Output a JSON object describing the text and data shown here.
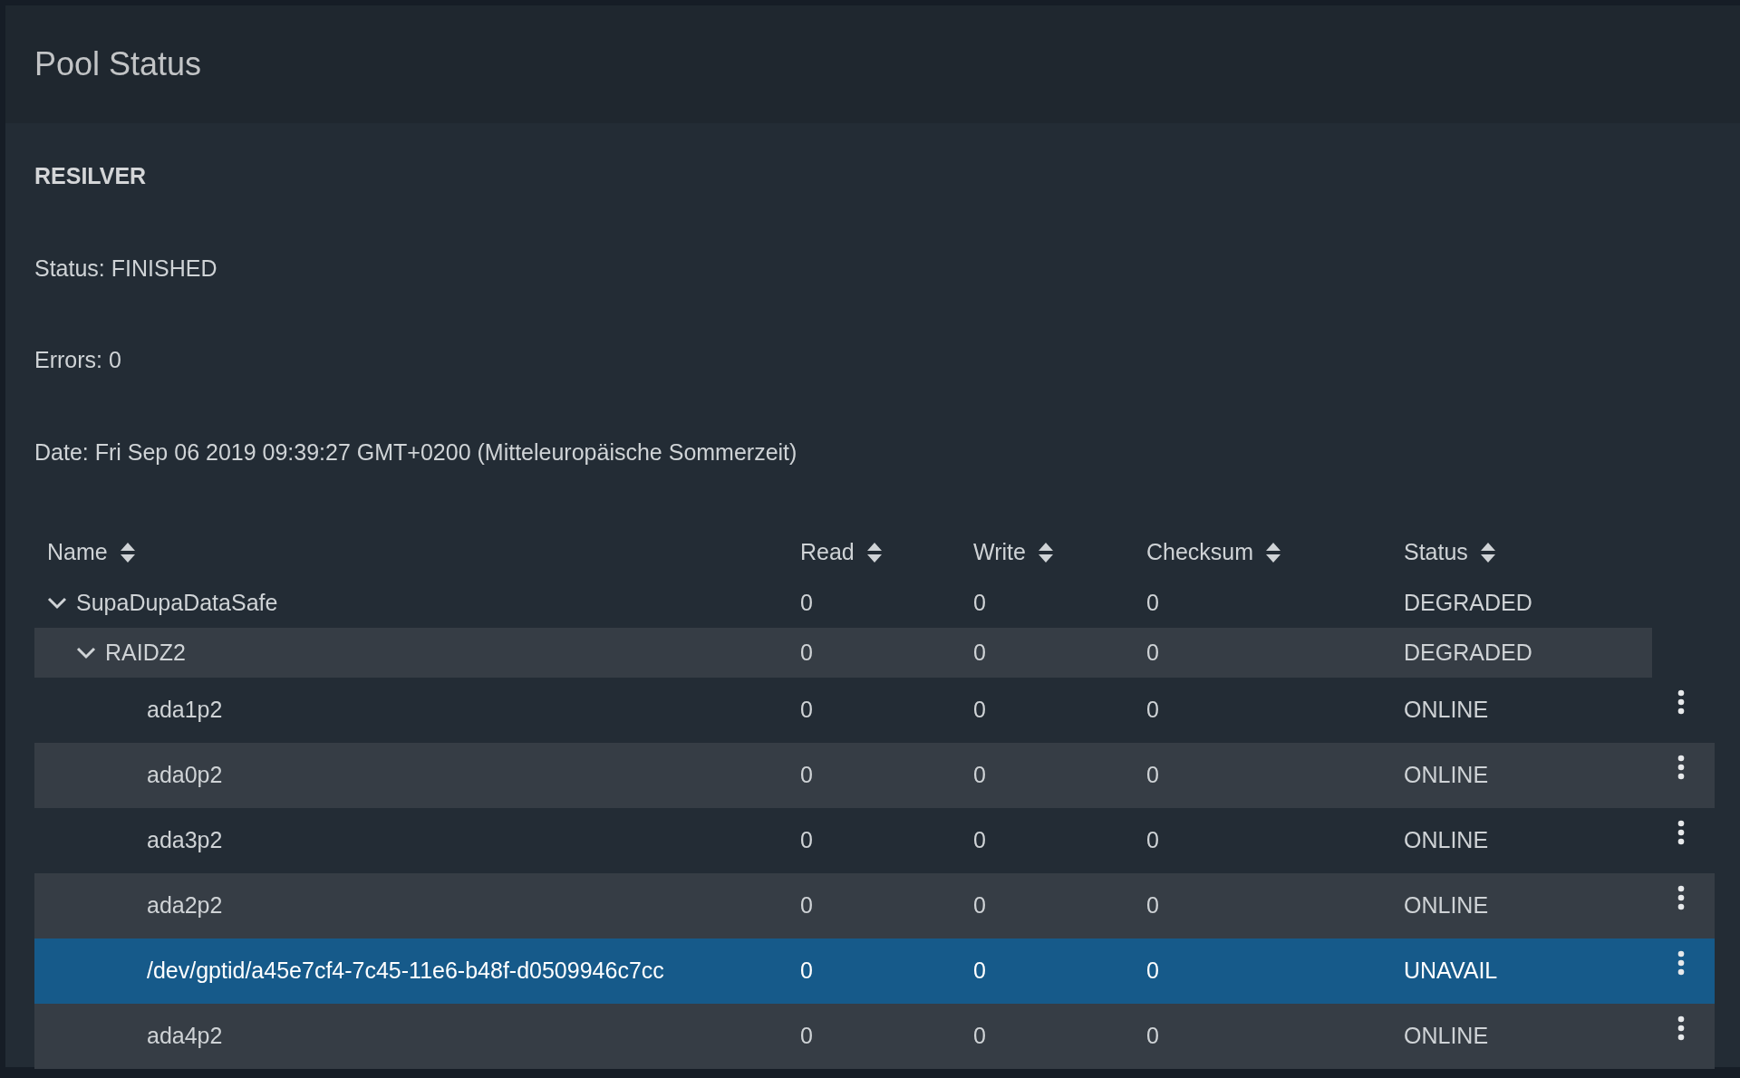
{
  "panel": {
    "title": "Pool Status"
  },
  "scan": {
    "heading": "RESILVER",
    "status": "Status: FINISHED",
    "errors": "Errors: 0",
    "date": "Date: Fri Sep 06 2019 09:39:27 GMT+0200 (Mitteleuropäische Sommerzeit)"
  },
  "table": {
    "columns": [
      "Name",
      "Read",
      "Write",
      "Checksum",
      "Status"
    ],
    "rows": [
      {
        "name": "SupaDupaDataSafe",
        "read": "0",
        "write": "0",
        "checksum": "0",
        "status": "DEGRADED",
        "expanded": true,
        "selected": false,
        "children": [
          {
            "name": "RAIDZ2",
            "read": "0",
            "write": "0",
            "checksum": "0",
            "status": "DEGRADED",
            "expanded": true,
            "selected": false,
            "children": [
              {
                "name": "ada1p2",
                "read": "0",
                "write": "0",
                "checksum": "0",
                "status": "ONLINE",
                "selected": false
              },
              {
                "name": "ada0p2",
                "read": "0",
                "write": "0",
                "checksum": "0",
                "status": "ONLINE",
                "selected": false
              },
              {
                "name": "ada3p2",
                "read": "0",
                "write": "0",
                "checksum": "0",
                "status": "ONLINE",
                "selected": false
              },
              {
                "name": "ada2p2",
                "read": "0",
                "write": "0",
                "checksum": "0",
                "status": "ONLINE",
                "selected": false
              },
              {
                "name": "/dev/gptid/a45e7cf4-7c45-11e6-b48f-d0509946c7cc",
                "read": "0",
                "write": "0",
                "checksum": "0",
                "status": "UNAVAIL",
                "selected": true
              },
              {
                "name": "ada4p2",
                "read": "0",
                "write": "0",
                "checksum": "0",
                "status": "ONLINE",
                "selected": false
              }
            ]
          }
        ]
      }
    ]
  }
}
